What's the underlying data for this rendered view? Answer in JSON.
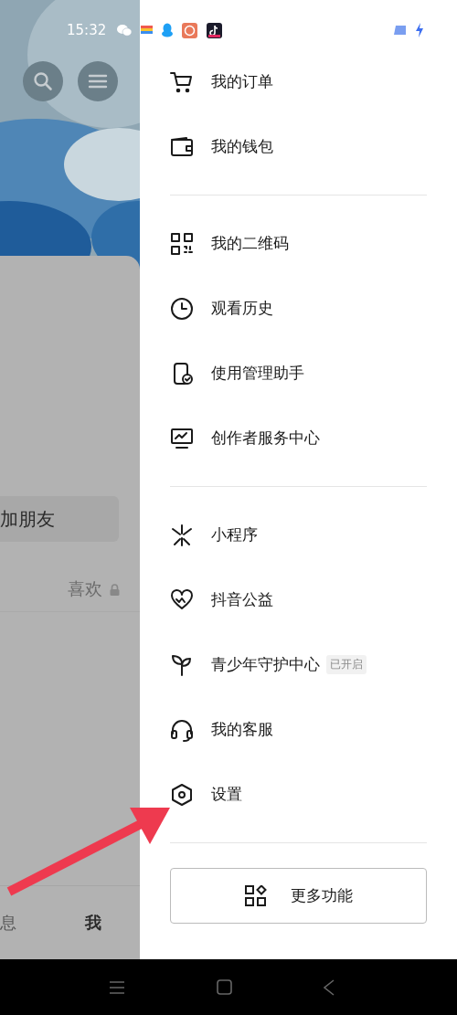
{
  "status_bar": {
    "time": "15:32"
  },
  "background_page": {
    "add_friend_button": "加朋友",
    "tabs": [
      {
        "label": "喜欢",
        "locked": true
      }
    ],
    "bottom_tabs": [
      {
        "label": "息",
        "selected": false
      },
      {
        "label": "我",
        "selected": true
      }
    ]
  },
  "drawer": {
    "sections": [
      {
        "items": [
          {
            "label": "我的订单"
          },
          {
            "label": "我的钱包"
          }
        ]
      },
      {
        "items": [
          {
            "label": "我的二维码"
          },
          {
            "label": "观看历史"
          },
          {
            "label": "使用管理助手"
          },
          {
            "label": "创作者服务中心"
          }
        ]
      },
      {
        "items": [
          {
            "label": "小程序"
          },
          {
            "label": "抖音公益"
          },
          {
            "label": "青少年守护中心",
            "badge": "已开启"
          },
          {
            "label": "我的客服"
          },
          {
            "label": "设置"
          }
        ]
      }
    ],
    "more_button": "更多功能"
  }
}
